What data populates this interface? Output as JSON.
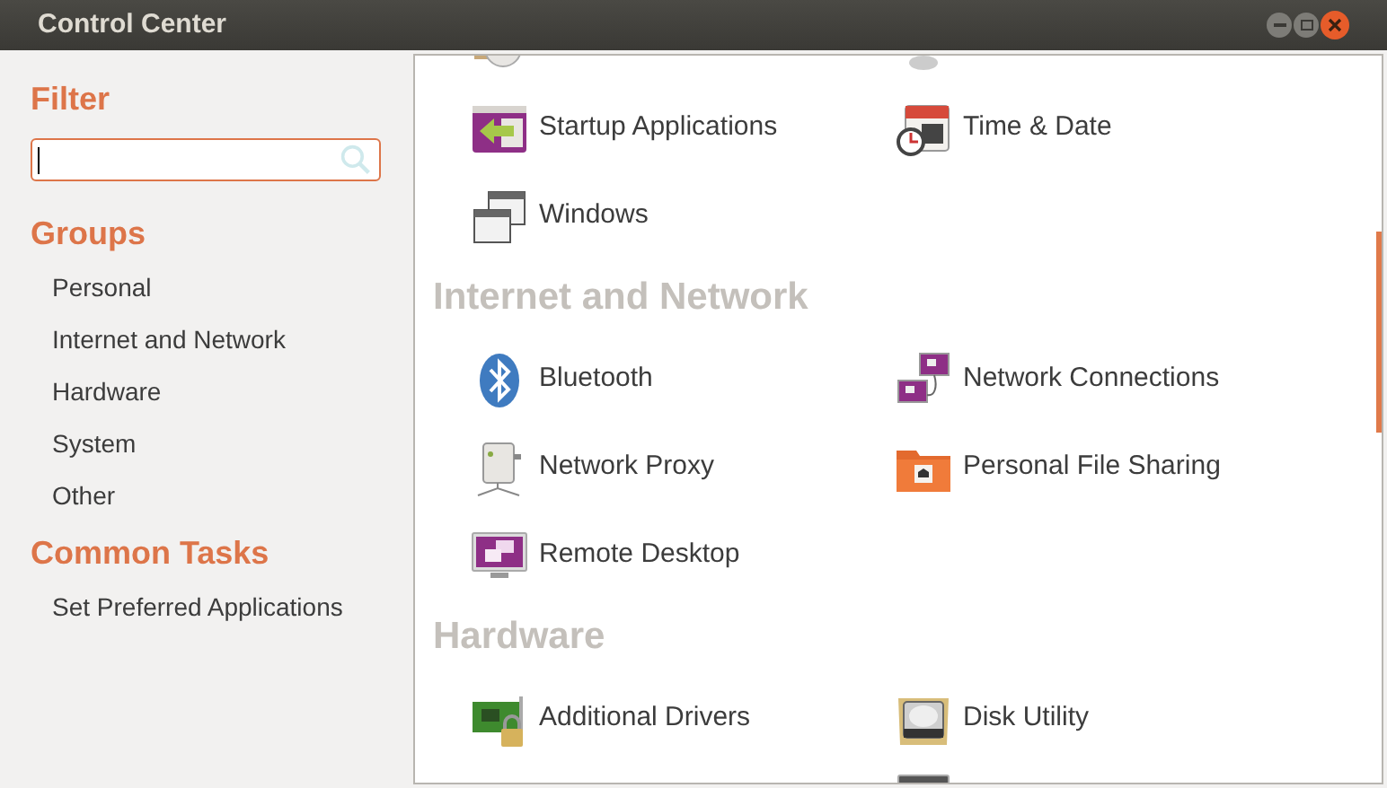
{
  "window": {
    "title": "Control Center"
  },
  "sidebar": {
    "filter_heading": "Filter",
    "groups_heading": "Groups",
    "groups": [
      "Personal",
      "Internet and Network",
      "Hardware",
      "System",
      "Other"
    ],
    "tasks_heading": "Common Tasks",
    "tasks": [
      "Set Preferred Applications"
    ]
  },
  "sections": [
    {
      "items": [
        "Startup Applications",
        "Time & Date",
        "Windows"
      ]
    },
    {
      "heading": "Internet and Network",
      "items": [
        "Bluetooth",
        "Network Connections",
        "Network Proxy",
        "Personal File Sharing",
        "Remote Desktop"
      ]
    },
    {
      "heading": "Hardware",
      "items": [
        "Additional Drivers",
        "Disk Utility"
      ]
    }
  ]
}
